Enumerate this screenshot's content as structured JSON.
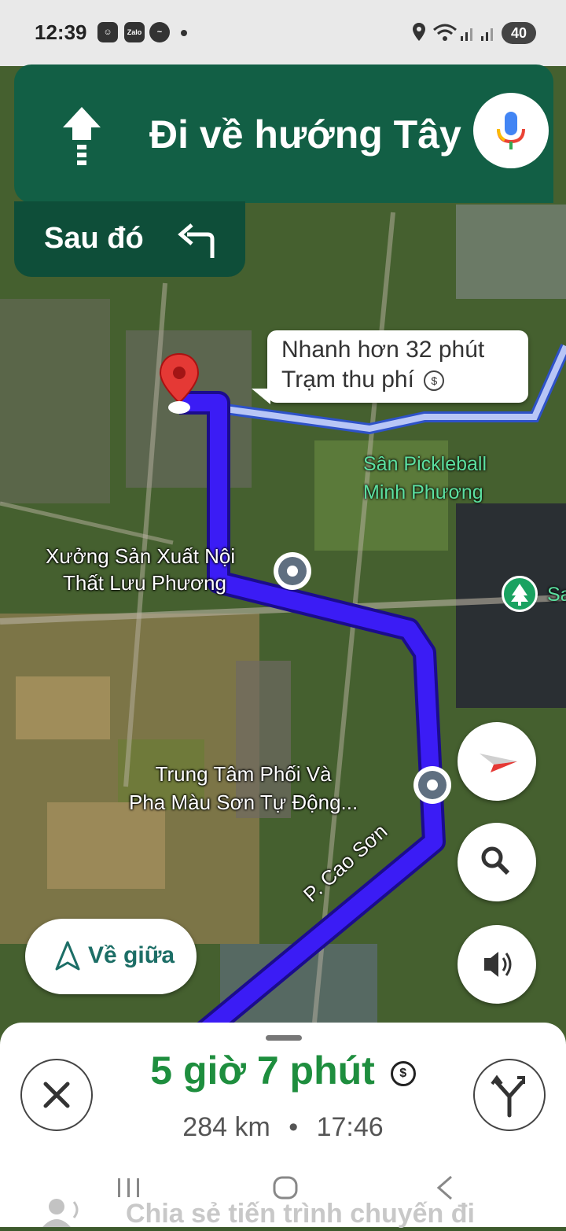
{
  "status_bar": {
    "time": "12:39",
    "app_icons": [
      "smiley-icon",
      "zalo-icon",
      "messenger-icon"
    ],
    "zalo_label": "Zalo",
    "battery": "40"
  },
  "banner": {
    "direction": "Đi về hướng Tây",
    "then_label": "Sau đó"
  },
  "route_callout": {
    "line1": "Nhanh hơn 32 phút",
    "line2": "Trạm thu phí"
  },
  "map_labels": {
    "place1": [
      "Xưởng Sản Xuất Nội",
      "Thất Lưu Phương"
    ],
    "place2": [
      "Trung Tâm Phối Và",
      "Pha Màu Sơn Tự Động..."
    ],
    "park": [
      "Sân Pickleball",
      "Minh Phương"
    ],
    "road": "P. Cao Sơn",
    "edge": "Sa"
  },
  "recenter_label": "Về giữa",
  "trip": {
    "eta": "5 giờ 7 phút",
    "distance": "284 km",
    "separator": "•",
    "arrival": "17:46"
  },
  "share_text": "Chia sẻ tiến trình chuyến đi",
  "colors": {
    "route": "#3b1cf5",
    "banner": "#125f45",
    "eta": "#1e8e3e"
  }
}
